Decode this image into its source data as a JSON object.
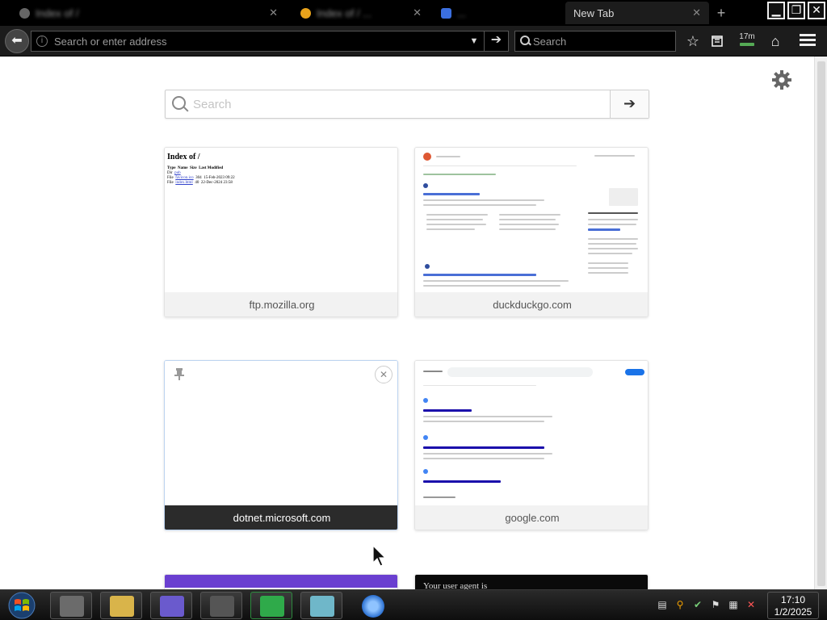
{
  "browser": {
    "tabs": [
      {
        "title": "Index of /",
        "blurred": true
      },
      {
        "title": "Index of / ...",
        "blurred": true
      },
      {
        "title": "...",
        "blurred": true
      },
      {
        "title": "New Tab",
        "active": true
      }
    ],
    "new_tab_symbol": "+",
    "window_buttons": {
      "minimize": "▁",
      "maximize": "❐",
      "close": "✕"
    },
    "address_bar": {
      "value": "",
      "placeholder": "Search or enter address"
    },
    "search_bar": {
      "value": "",
      "placeholder": "Search"
    },
    "toolbar_badge": "17m"
  },
  "new_tab_page": {
    "search": {
      "placeholder": "Search",
      "go_symbol": "➔"
    },
    "tiles": [
      {
        "label": "ftp.mozilla.org"
      },
      {
        "label": "duckduckgo.com"
      },
      {
        "label": "dotnet.microsoft.com"
      },
      {
        "label": "google.com"
      }
    ],
    "ftp_preview": {
      "title": "Index of /",
      "headers": [
        "Type",
        "Name",
        "Size",
        "Last Modified"
      ],
      "rows": [
        [
          "Dir",
          "pub",
          "",
          ""
        ],
        [
          "File",
          "favicon.ico",
          "304",
          "15-Feb-2023 09:22"
        ],
        [
          "File",
          "index.html",
          "40",
          "22-Dec-2024 23:58"
        ]
      ]
    },
    "bottom_preview_text": "Your user agent is"
  },
  "taskbar": {
    "time": "17:10",
    "date": "1/2/2025"
  }
}
